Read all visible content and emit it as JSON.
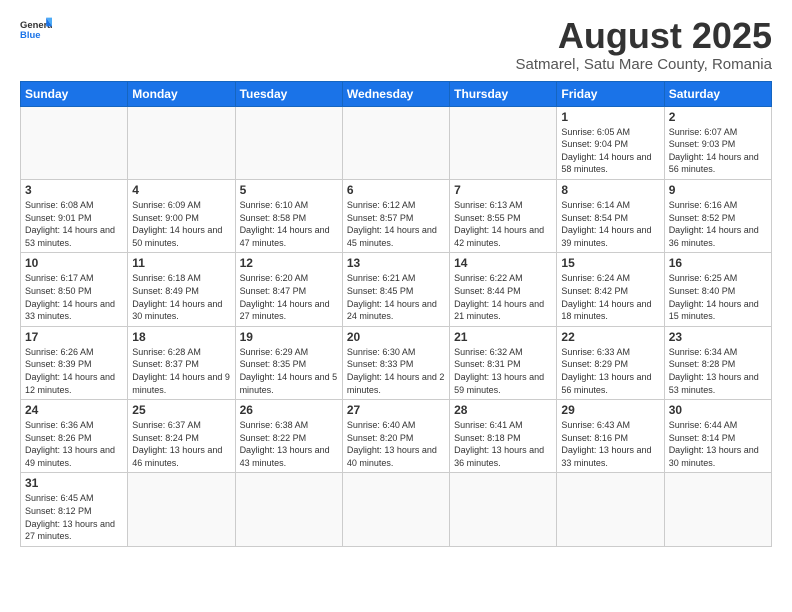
{
  "header": {
    "logo_general": "General",
    "logo_blue": "Blue",
    "title": "August 2025",
    "subtitle": "Satmarel, Satu Mare County, Romania"
  },
  "weekdays": [
    "Sunday",
    "Monday",
    "Tuesday",
    "Wednesday",
    "Thursday",
    "Friday",
    "Saturday"
  ],
  "weeks": [
    [
      {
        "day": "",
        "info": ""
      },
      {
        "day": "",
        "info": ""
      },
      {
        "day": "",
        "info": ""
      },
      {
        "day": "",
        "info": ""
      },
      {
        "day": "",
        "info": ""
      },
      {
        "day": "1",
        "info": "Sunrise: 6:05 AM\nSunset: 9:04 PM\nDaylight: 14 hours\nand 58 minutes."
      },
      {
        "day": "2",
        "info": "Sunrise: 6:07 AM\nSunset: 9:03 PM\nDaylight: 14 hours\nand 56 minutes."
      }
    ],
    [
      {
        "day": "3",
        "info": "Sunrise: 6:08 AM\nSunset: 9:01 PM\nDaylight: 14 hours\nand 53 minutes."
      },
      {
        "day": "4",
        "info": "Sunrise: 6:09 AM\nSunset: 9:00 PM\nDaylight: 14 hours\nand 50 minutes."
      },
      {
        "day": "5",
        "info": "Sunrise: 6:10 AM\nSunset: 8:58 PM\nDaylight: 14 hours\nand 47 minutes."
      },
      {
        "day": "6",
        "info": "Sunrise: 6:12 AM\nSunset: 8:57 PM\nDaylight: 14 hours\nand 45 minutes."
      },
      {
        "day": "7",
        "info": "Sunrise: 6:13 AM\nSunset: 8:55 PM\nDaylight: 14 hours\nand 42 minutes."
      },
      {
        "day": "8",
        "info": "Sunrise: 6:14 AM\nSunset: 8:54 PM\nDaylight: 14 hours\nand 39 minutes."
      },
      {
        "day": "9",
        "info": "Sunrise: 6:16 AM\nSunset: 8:52 PM\nDaylight: 14 hours\nand 36 minutes."
      }
    ],
    [
      {
        "day": "10",
        "info": "Sunrise: 6:17 AM\nSunset: 8:50 PM\nDaylight: 14 hours\nand 33 minutes."
      },
      {
        "day": "11",
        "info": "Sunrise: 6:18 AM\nSunset: 8:49 PM\nDaylight: 14 hours\nand 30 minutes."
      },
      {
        "day": "12",
        "info": "Sunrise: 6:20 AM\nSunset: 8:47 PM\nDaylight: 14 hours\nand 27 minutes."
      },
      {
        "day": "13",
        "info": "Sunrise: 6:21 AM\nSunset: 8:45 PM\nDaylight: 14 hours\nand 24 minutes."
      },
      {
        "day": "14",
        "info": "Sunrise: 6:22 AM\nSunset: 8:44 PM\nDaylight: 14 hours\nand 21 minutes."
      },
      {
        "day": "15",
        "info": "Sunrise: 6:24 AM\nSunset: 8:42 PM\nDaylight: 14 hours\nand 18 minutes."
      },
      {
        "day": "16",
        "info": "Sunrise: 6:25 AM\nSunset: 8:40 PM\nDaylight: 14 hours\nand 15 minutes."
      }
    ],
    [
      {
        "day": "17",
        "info": "Sunrise: 6:26 AM\nSunset: 8:39 PM\nDaylight: 14 hours\nand 12 minutes."
      },
      {
        "day": "18",
        "info": "Sunrise: 6:28 AM\nSunset: 8:37 PM\nDaylight: 14 hours\nand 9 minutes."
      },
      {
        "day": "19",
        "info": "Sunrise: 6:29 AM\nSunset: 8:35 PM\nDaylight: 14 hours\nand 5 minutes."
      },
      {
        "day": "20",
        "info": "Sunrise: 6:30 AM\nSunset: 8:33 PM\nDaylight: 14 hours\nand 2 minutes."
      },
      {
        "day": "21",
        "info": "Sunrise: 6:32 AM\nSunset: 8:31 PM\nDaylight: 13 hours\nand 59 minutes."
      },
      {
        "day": "22",
        "info": "Sunrise: 6:33 AM\nSunset: 8:29 PM\nDaylight: 13 hours\nand 56 minutes."
      },
      {
        "day": "23",
        "info": "Sunrise: 6:34 AM\nSunset: 8:28 PM\nDaylight: 13 hours\nand 53 minutes."
      }
    ],
    [
      {
        "day": "24",
        "info": "Sunrise: 6:36 AM\nSunset: 8:26 PM\nDaylight: 13 hours\nand 49 minutes."
      },
      {
        "day": "25",
        "info": "Sunrise: 6:37 AM\nSunset: 8:24 PM\nDaylight: 13 hours\nand 46 minutes."
      },
      {
        "day": "26",
        "info": "Sunrise: 6:38 AM\nSunset: 8:22 PM\nDaylight: 13 hours\nand 43 minutes."
      },
      {
        "day": "27",
        "info": "Sunrise: 6:40 AM\nSunset: 8:20 PM\nDaylight: 13 hours\nand 40 minutes."
      },
      {
        "day": "28",
        "info": "Sunrise: 6:41 AM\nSunset: 8:18 PM\nDaylight: 13 hours\nand 36 minutes."
      },
      {
        "day": "29",
        "info": "Sunrise: 6:43 AM\nSunset: 8:16 PM\nDaylight: 13 hours\nand 33 minutes."
      },
      {
        "day": "30",
        "info": "Sunrise: 6:44 AM\nSunset: 8:14 PM\nDaylight: 13 hours\nand 30 minutes."
      }
    ],
    [
      {
        "day": "31",
        "info": "Sunrise: 6:45 AM\nSunset: 8:12 PM\nDaylight: 13 hours\nand 27 minutes."
      },
      {
        "day": "",
        "info": ""
      },
      {
        "day": "",
        "info": ""
      },
      {
        "day": "",
        "info": ""
      },
      {
        "day": "",
        "info": ""
      },
      {
        "day": "",
        "info": ""
      },
      {
        "day": "",
        "info": ""
      }
    ]
  ]
}
